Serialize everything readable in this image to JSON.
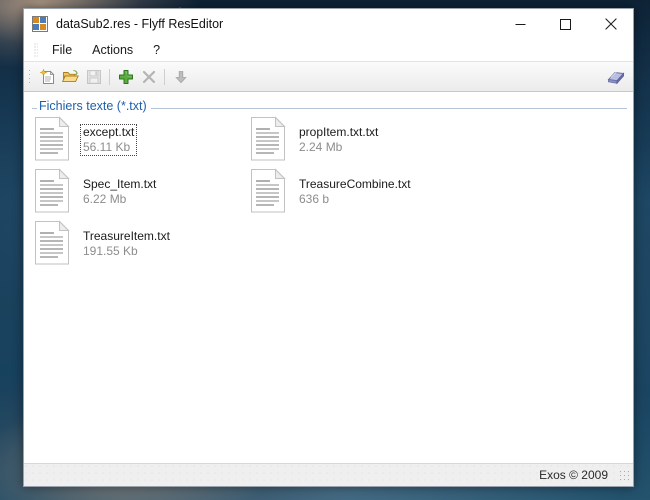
{
  "window": {
    "title": "dataSub2.res - Flyff ResEditor",
    "app_icon": "vs-app-icon",
    "controls": {
      "minimize": "minimize-icon",
      "maximize": "maximize-icon",
      "close": "close-icon"
    }
  },
  "menu": {
    "items": [
      {
        "label": "File",
        "name": "menu-file"
      },
      {
        "label": "Actions",
        "name": "menu-actions"
      },
      {
        "label": "?",
        "name": "menu-help"
      }
    ]
  },
  "toolbar": {
    "buttons": [
      {
        "name": "new-file-button",
        "icon": "new-document-icon",
        "enabled": true
      },
      {
        "name": "open-file-button",
        "icon": "open-folder-icon",
        "enabled": true
      },
      {
        "name": "save-file-button",
        "icon": "save-diskette-icon",
        "enabled": false
      },
      {
        "name": "add-item-button",
        "icon": "green-plus-icon",
        "enabled": true
      },
      {
        "name": "remove-item-button",
        "icon": "gray-x-icon",
        "enabled": false
      },
      {
        "name": "export-button",
        "icon": "down-arrow-icon",
        "enabled": false
      }
    ],
    "right_button": {
      "name": "about-book-button",
      "icon": "book-icon"
    }
  },
  "groupbox": {
    "label": "Fichiers texte (*.txt)"
  },
  "files": [
    {
      "name": "except.txt",
      "size": "56.11 Kb",
      "selected": true,
      "col": 0,
      "row": 0
    },
    {
      "name": "propItem.txt.txt",
      "size": "2.24 Mb",
      "selected": false,
      "col": 1,
      "row": 0
    },
    {
      "name": "Spec_Item.txt",
      "size": "6.22 Mb",
      "selected": false,
      "col": 0,
      "row": 1
    },
    {
      "name": "TreasureCombine.txt",
      "size": "636 b",
      "selected": false,
      "col": 1,
      "row": 1
    },
    {
      "name": "TreasureItem.txt",
      "size": "191.55 Kb",
      "selected": false,
      "col": 0,
      "row": 2
    }
  ],
  "statusbar": {
    "text": "Exos © 2009",
    "grip": "resize-grip-icon"
  },
  "colors": {
    "groupbox_label": "#1f5fa8",
    "groupbox_line": "#b4c3d6",
    "file_size_text": "#8d8d8d",
    "file_name_text": "#1b1b1b",
    "window_bg": "#ffffff",
    "statusbar_bg": "#efefef",
    "accent_green": "#4f9b3a",
    "accent_orange": "#d88a22",
    "accent_blue": "#4a7ebb"
  }
}
